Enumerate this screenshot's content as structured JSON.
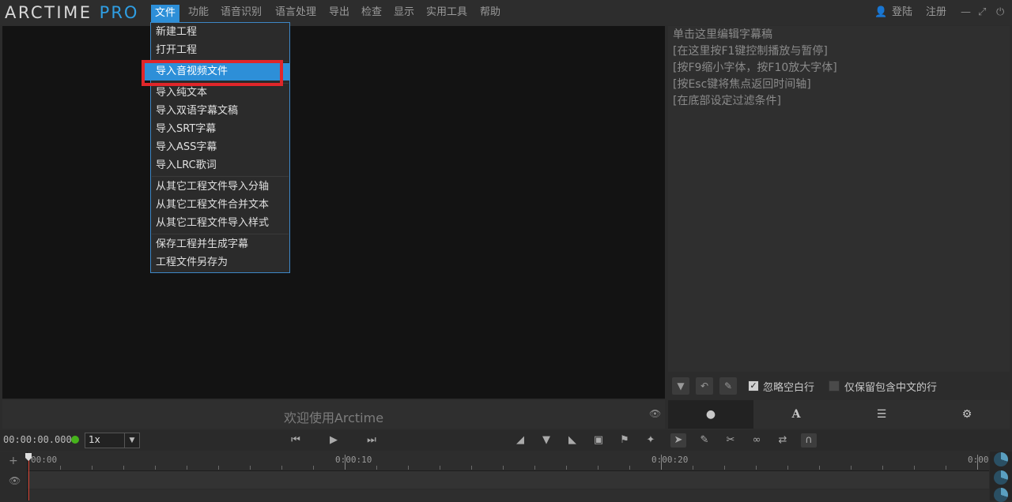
{
  "app": {
    "logo_main": "ARCTIME ",
    "logo_pro": "PRO"
  },
  "menubar": {
    "items": [
      "文件",
      "功能",
      "语音识别",
      "语言处理",
      "导出",
      "检查",
      "显示",
      "实用工具",
      "帮助"
    ],
    "active_index": 0,
    "right": {
      "login": "登陆",
      "register": "注册"
    }
  },
  "file_menu": {
    "items": [
      "新建工程",
      "打开工程",
      "导入音视频文件",
      "导入纯文本",
      "导入双语字幕文稿",
      "导入SRT字幕",
      "导入ASS字幕",
      "导入LRC歌词",
      "从其它工程文件导入分轴",
      "从其它工程文件合并文本",
      "从其它工程文件导入样式",
      "保存工程并生成字幕",
      "工程文件另存为"
    ],
    "highlighted": "导入音视频文件"
  },
  "video": {
    "welcome": "欢迎使用Arctime"
  },
  "subtitle_editor": {
    "lines": [
      "单击这里编辑字幕稿",
      "[在这里按F1键控制播放与暂停]",
      "[按F9缩小字体，按F10放大字体]",
      "[按Esc键将焦点返回时间轴]",
      "[在底部设定过滤条件]"
    ]
  },
  "filters": {
    "ignore_blank": {
      "label": "忽略空白行",
      "checked": true
    },
    "chinese_only": {
      "label": "仅保留包含中文的行",
      "checked": false
    }
  },
  "right_tabs": [
    "chat-icon",
    "font-style-icon",
    "list-icon",
    "settings-icon"
  ],
  "transport": {
    "timecode": "00:00:00.000",
    "speed": "1x"
  },
  "timeline": {
    "labels": [
      "00:00",
      "0:00:10",
      "0:00:20",
      "0:00:"
    ]
  },
  "colors": {
    "accent": "#2d8fd8",
    "highlight_box": "#e0262a",
    "status_green": "#46b31b"
  }
}
